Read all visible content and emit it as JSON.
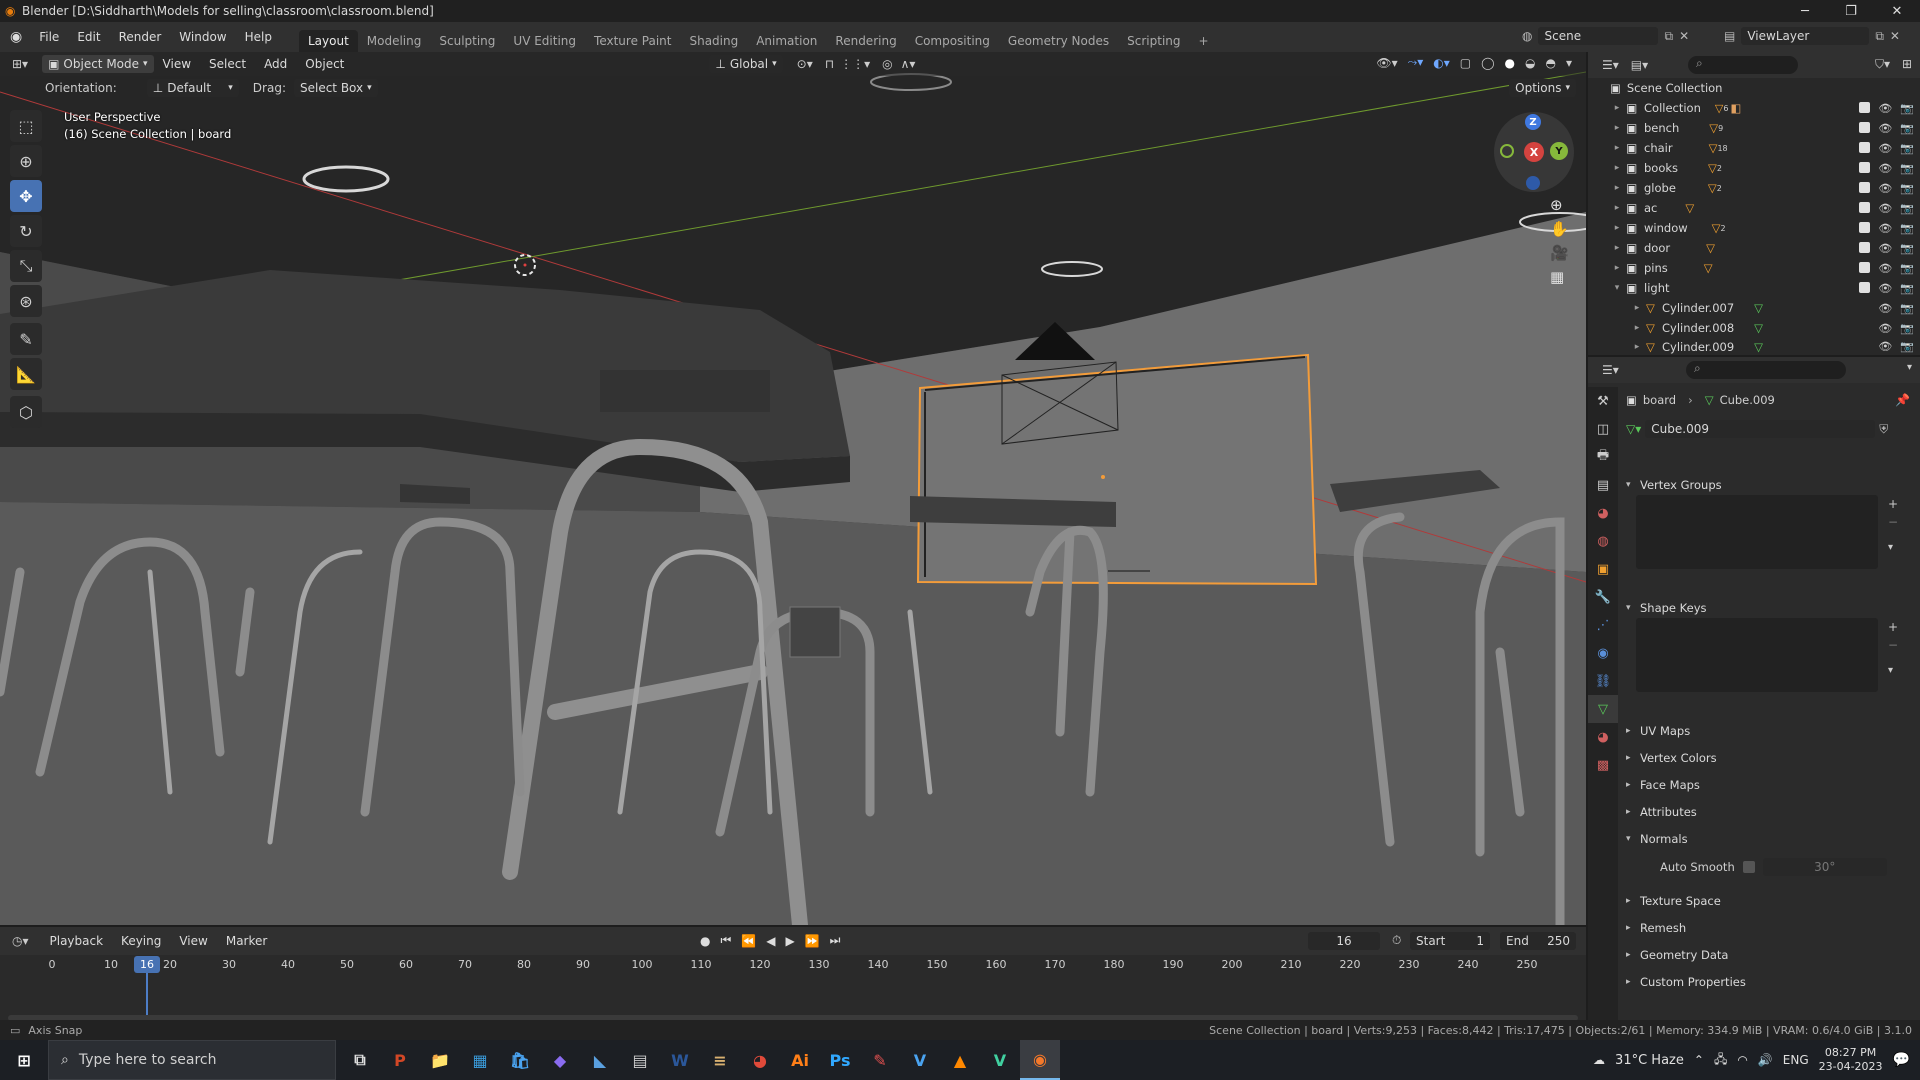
{
  "window": {
    "title": "Blender [D:\\Siddharth\\Models for selling\\classroom\\classroom.blend]",
    "controls": [
      "minimize-icon",
      "maximize-icon",
      "close-icon"
    ]
  },
  "menu": {
    "items": [
      "File",
      "Edit",
      "Render",
      "Window",
      "Help"
    ],
    "workspaces": [
      "Layout",
      "Modeling",
      "Sculpting",
      "UV Editing",
      "Texture Paint",
      "Shading",
      "Animation",
      "Rendering",
      "Compositing",
      "Geometry Nodes",
      "Scripting",
      "+"
    ],
    "active_workspace": "Layout",
    "scene": "Scene",
    "view_layer": "ViewLayer"
  },
  "viewport": {
    "mode": "Object Mode",
    "menus": [
      "View",
      "Select",
      "Add",
      "Object"
    ],
    "transform_orientation": "Global",
    "orientation_label": "Orientation:",
    "orientation_value": "Default",
    "drag_label": "Drag:",
    "drag_value": "Select Box",
    "options_label": "Options",
    "overlay_line1": "User Perspective",
    "overlay_line2": "(16) Scene Collection | board",
    "gizmo_axes": {
      "x": "X",
      "y": "Y",
      "z": "Z"
    },
    "colors": {
      "x_axis": "#c0392b",
      "y_axis": "#7ea33b",
      "z_axis": "#3b6fd8",
      "selection": "#f39c3a"
    }
  },
  "tools": [
    "select-box-icon",
    "cursor-icon",
    "move-icon",
    "rotate-icon",
    "scale-icon",
    "transform-icon",
    "annotate-icon",
    "measure-icon",
    "add-cube-icon"
  ],
  "outliner": {
    "root": "Scene Collection",
    "rows": [
      {
        "name": "Collection",
        "badge": "6"
      },
      {
        "name": "bench",
        "badge": "9"
      },
      {
        "name": "chair",
        "badge": "18"
      },
      {
        "name": "books",
        "badge": "2"
      },
      {
        "name": "globe",
        "badge": "2"
      },
      {
        "name": "ac",
        "badge": ""
      },
      {
        "name": "window",
        "badge": "2"
      },
      {
        "name": "door",
        "badge": ""
      },
      {
        "name": "pins",
        "badge": ""
      },
      {
        "name": "light",
        "badge": ""
      },
      {
        "name": "Cylinder.007",
        "badge": ""
      },
      {
        "name": "Cylinder.008",
        "badge": ""
      },
      {
        "name": "Cylinder.009",
        "badge": ""
      }
    ]
  },
  "properties": {
    "breadcrumb_object": "board",
    "breadcrumb_data": "Cube.009",
    "data_name": "Cube.009",
    "panels": {
      "vertex_groups": "Vertex Groups",
      "shape_keys": "Shape Keys",
      "uv_maps": "UV Maps",
      "vertex_colors": "Vertex Colors",
      "face_maps": "Face Maps",
      "attributes": "Attributes",
      "normals": "Normals",
      "auto_smooth": "Auto Smooth",
      "auto_smooth_angle": "30°",
      "texture_space": "Texture Space",
      "remesh": "Remesh",
      "geometry_data": "Geometry Data",
      "custom_properties": "Custom Properties"
    }
  },
  "timeline": {
    "menus": [
      "Playback",
      "Keying",
      "View",
      "Marker"
    ],
    "current_frame": "16",
    "start_label": "Start",
    "start": "1",
    "end_label": "End",
    "end": "250",
    "ticks": [
      "0",
      "10",
      "20",
      "30",
      "40",
      "50",
      "60",
      "70",
      "80",
      "90",
      "100",
      "110",
      "120",
      "130",
      "140",
      "150",
      "160",
      "170",
      "180",
      "190",
      "200",
      "210",
      "220",
      "230",
      "240",
      "250"
    ]
  },
  "status": {
    "left": "Axis Snap",
    "right": "Scene Collection | board | Verts:9,253 | Faces:8,442 | Tris:17,475 | Objects:2/61 | Memory: 334.9 MiB | VRAM: 0.6/4.0 GiB | 3.1.0"
  },
  "taskbar": {
    "search_placeholder": "Type here to search",
    "weather": "31°C Haze",
    "language": "ENG",
    "time": "08:27 PM",
    "date": "23-04-2023"
  }
}
